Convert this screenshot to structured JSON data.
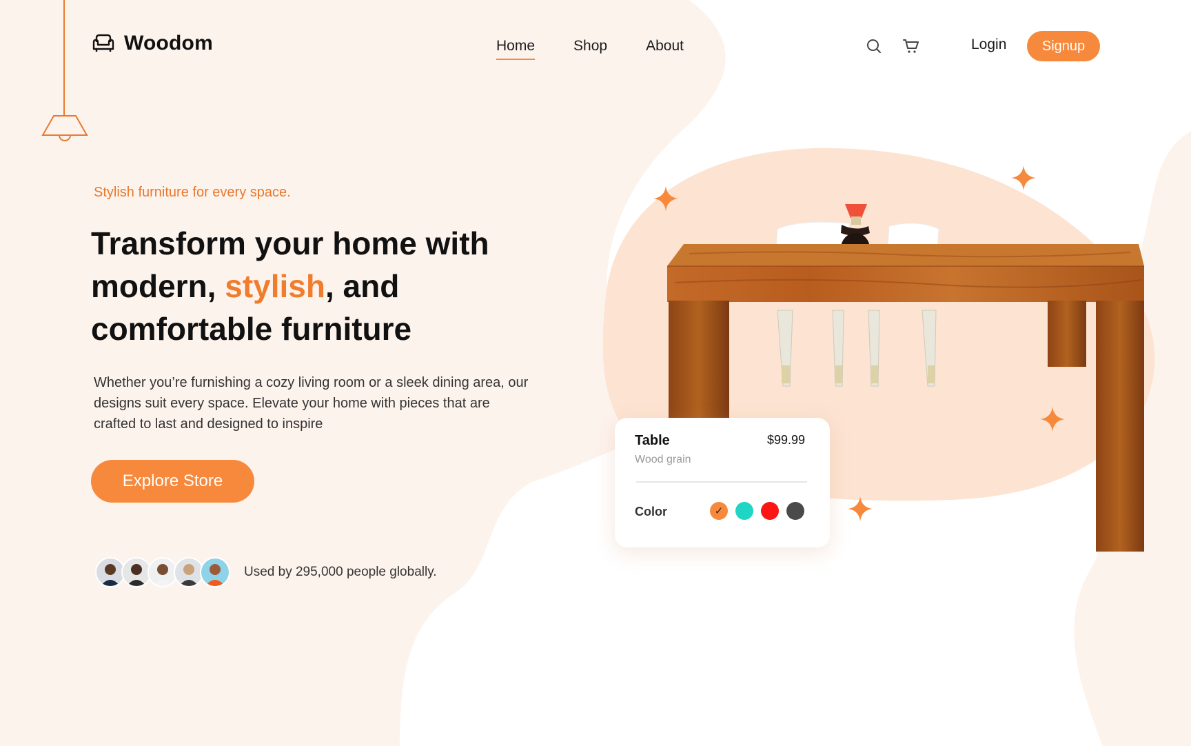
{
  "brand": {
    "name": "Woodom",
    "logo_icon": "armchair-icon"
  },
  "nav": {
    "items": [
      {
        "label": "Home",
        "active": true
      },
      {
        "label": "Shop",
        "active": false
      },
      {
        "label": "About",
        "active": false
      }
    ]
  },
  "header": {
    "search_icon": "search-icon",
    "cart_icon": "cart-icon",
    "login_label": "Login",
    "signup_label": "Signup"
  },
  "hero": {
    "tagline": "Stylish furniture for every space.",
    "headline_part1": "Transform your home with modern, ",
    "headline_accent": "stylish",
    "headline_part2": ", and comfortable furniture",
    "description": "Whether you’re furnishing a cozy living room or a sleek dining area, our designs suit every space. Elevate your home with pieces that are crafted to last and designed to inspire",
    "cta_label": "Explore Store",
    "social_proof": "Used by 295,000 people globally."
  },
  "product_card": {
    "name": "Table",
    "price": "$99.99",
    "material": "Wood grain",
    "color_label": "Color",
    "colors": [
      {
        "hex": "#f6893c",
        "selected": true
      },
      {
        "hex": "#1fd6c4",
        "selected": false
      },
      {
        "hex": "#fc1515",
        "selected": false
      },
      {
        "hex": "#4a4a4a",
        "selected": false
      }
    ]
  },
  "theme": {
    "accent": "#f6893c",
    "blob": "#fdf3ed",
    "blob_product": "#fde3d2"
  }
}
